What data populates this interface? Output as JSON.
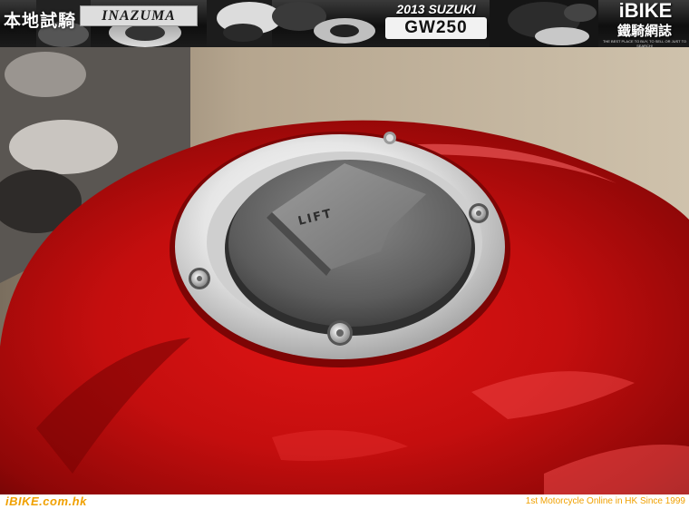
{
  "banner": {
    "article_section": "本地試騎",
    "model_logo": "INAZUMA",
    "year_make": "2013 SUZUKI",
    "model": "GW250",
    "brand": "iBIKE",
    "brand_chinese": "鐵騎網誌",
    "brand_tagline": "THE BEST PLACE TO BUY, TO SELL OR JUST TO SEARCH!"
  },
  "photo": {
    "cap_label": "LIFT",
    "subject_colors": {
      "tank_red": "#c81010",
      "cap_grey": "#6a6a6a",
      "ring_silver": "#e2e2e2"
    }
  },
  "footer": {
    "site_url": "iBIKE.com.hk",
    "tagline": "1st  Motorcycle Online in HK Since 1999"
  },
  "colors": {
    "accent_orange": "#f0a000",
    "banner_dark": "#111111"
  }
}
